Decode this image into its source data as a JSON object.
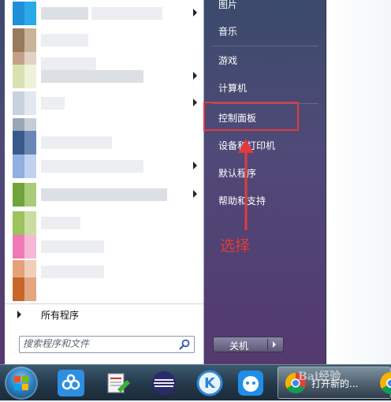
{
  "left_panel": {
    "all_programs_label": "所有程序",
    "search_placeholder": "搜索程序和文件"
  },
  "right_panel": {
    "items": [
      {
        "label": "图片"
      },
      {
        "label": "音乐"
      },
      {
        "label": "游戏"
      },
      {
        "label": "计算机"
      },
      {
        "label": "控制面板"
      },
      {
        "label": "设备和打印机"
      },
      {
        "label": "默认程序"
      },
      {
        "label": "帮助和支持"
      }
    ],
    "shutdown_label": "关机"
  },
  "annotation": {
    "label": "选择",
    "color": "#e23b3b"
  },
  "taskbar": {
    "active_window_label": "打开新的...",
    "watermark": "Bai经验"
  },
  "colors": {
    "menu_gradient_top": "#3b4a6b",
    "menu_gradient_bottom": "#54396e",
    "highlight": "#e23b3b"
  }
}
